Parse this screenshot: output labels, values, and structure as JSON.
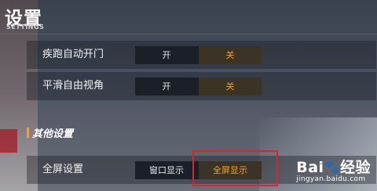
{
  "header": {
    "title": "设置",
    "subtitle": "SETTINGS"
  },
  "settings": [
    {
      "label": "疾跑自动开门",
      "options": [
        "开",
        "关"
      ],
      "selected": "关"
    },
    {
      "label": "平滑自由视角",
      "options": [
        "开",
        "关"
      ],
      "selected": "关"
    }
  ],
  "other_section": {
    "title": "其他设置",
    "accent_color": "#f0a430",
    "rows": [
      {
        "label": "全屏设置",
        "options": [
          "窗口显示",
          "全屏显示"
        ],
        "selected": "全屏显示"
      }
    ]
  },
  "watermark": {
    "logo": "Bai",
    "logo_paw": "🐾",
    "logo_suffix": "经验",
    "url": "jingyan.baidu.com"
  },
  "colors": {
    "selected_text": "#f0a430",
    "highlight_box": "#d9262e"
  }
}
